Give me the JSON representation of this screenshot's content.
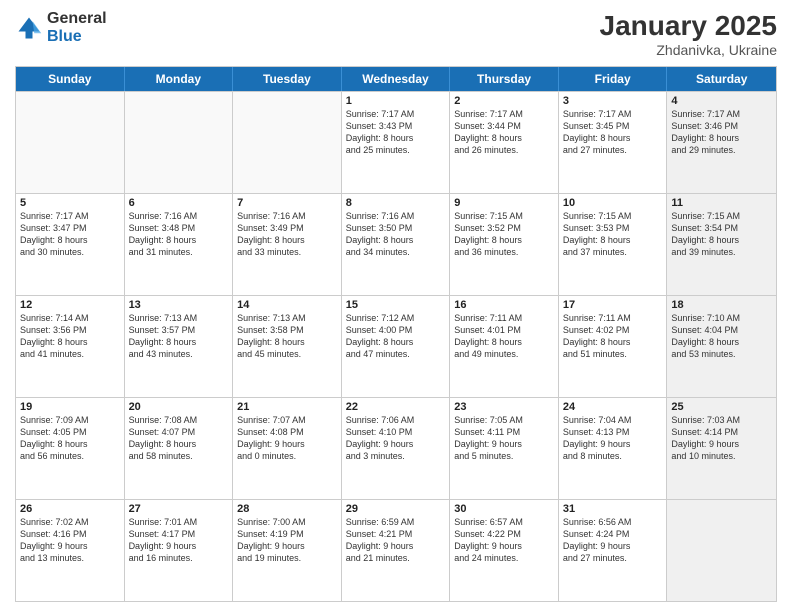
{
  "logo": {
    "general": "General",
    "blue": "Blue"
  },
  "title": {
    "month": "January 2025",
    "location": "Zhdanivka, Ukraine"
  },
  "header_days": [
    "Sunday",
    "Monday",
    "Tuesday",
    "Wednesday",
    "Thursday",
    "Friday",
    "Saturday"
  ],
  "rows": [
    [
      {
        "day": "",
        "text": "",
        "empty": true
      },
      {
        "day": "",
        "text": "",
        "empty": true
      },
      {
        "day": "",
        "text": "",
        "empty": true
      },
      {
        "day": "1",
        "text": "Sunrise: 7:17 AM\nSunset: 3:43 PM\nDaylight: 8 hours\nand 25 minutes."
      },
      {
        "day": "2",
        "text": "Sunrise: 7:17 AM\nSunset: 3:44 PM\nDaylight: 8 hours\nand 26 minutes."
      },
      {
        "day": "3",
        "text": "Sunrise: 7:17 AM\nSunset: 3:45 PM\nDaylight: 8 hours\nand 27 minutes."
      },
      {
        "day": "4",
        "text": "Sunrise: 7:17 AM\nSunset: 3:46 PM\nDaylight: 8 hours\nand 29 minutes.",
        "shaded": true
      }
    ],
    [
      {
        "day": "5",
        "text": "Sunrise: 7:17 AM\nSunset: 3:47 PM\nDaylight: 8 hours\nand 30 minutes."
      },
      {
        "day": "6",
        "text": "Sunrise: 7:16 AM\nSunset: 3:48 PM\nDaylight: 8 hours\nand 31 minutes."
      },
      {
        "day": "7",
        "text": "Sunrise: 7:16 AM\nSunset: 3:49 PM\nDaylight: 8 hours\nand 33 minutes."
      },
      {
        "day": "8",
        "text": "Sunrise: 7:16 AM\nSunset: 3:50 PM\nDaylight: 8 hours\nand 34 minutes."
      },
      {
        "day": "9",
        "text": "Sunrise: 7:15 AM\nSunset: 3:52 PM\nDaylight: 8 hours\nand 36 minutes."
      },
      {
        "day": "10",
        "text": "Sunrise: 7:15 AM\nSunset: 3:53 PM\nDaylight: 8 hours\nand 37 minutes."
      },
      {
        "day": "11",
        "text": "Sunrise: 7:15 AM\nSunset: 3:54 PM\nDaylight: 8 hours\nand 39 minutes.",
        "shaded": true
      }
    ],
    [
      {
        "day": "12",
        "text": "Sunrise: 7:14 AM\nSunset: 3:56 PM\nDaylight: 8 hours\nand 41 minutes."
      },
      {
        "day": "13",
        "text": "Sunrise: 7:13 AM\nSunset: 3:57 PM\nDaylight: 8 hours\nand 43 minutes."
      },
      {
        "day": "14",
        "text": "Sunrise: 7:13 AM\nSunset: 3:58 PM\nDaylight: 8 hours\nand 45 minutes."
      },
      {
        "day": "15",
        "text": "Sunrise: 7:12 AM\nSunset: 4:00 PM\nDaylight: 8 hours\nand 47 minutes."
      },
      {
        "day": "16",
        "text": "Sunrise: 7:11 AM\nSunset: 4:01 PM\nDaylight: 8 hours\nand 49 minutes."
      },
      {
        "day": "17",
        "text": "Sunrise: 7:11 AM\nSunset: 4:02 PM\nDaylight: 8 hours\nand 51 minutes."
      },
      {
        "day": "18",
        "text": "Sunrise: 7:10 AM\nSunset: 4:04 PM\nDaylight: 8 hours\nand 53 minutes.",
        "shaded": true
      }
    ],
    [
      {
        "day": "19",
        "text": "Sunrise: 7:09 AM\nSunset: 4:05 PM\nDaylight: 8 hours\nand 56 minutes."
      },
      {
        "day": "20",
        "text": "Sunrise: 7:08 AM\nSunset: 4:07 PM\nDaylight: 8 hours\nand 58 minutes."
      },
      {
        "day": "21",
        "text": "Sunrise: 7:07 AM\nSunset: 4:08 PM\nDaylight: 9 hours\nand 0 minutes."
      },
      {
        "day": "22",
        "text": "Sunrise: 7:06 AM\nSunset: 4:10 PM\nDaylight: 9 hours\nand 3 minutes."
      },
      {
        "day": "23",
        "text": "Sunrise: 7:05 AM\nSunset: 4:11 PM\nDaylight: 9 hours\nand 5 minutes."
      },
      {
        "day": "24",
        "text": "Sunrise: 7:04 AM\nSunset: 4:13 PM\nDaylight: 9 hours\nand 8 minutes."
      },
      {
        "day": "25",
        "text": "Sunrise: 7:03 AM\nSunset: 4:14 PM\nDaylight: 9 hours\nand 10 minutes.",
        "shaded": true
      }
    ],
    [
      {
        "day": "26",
        "text": "Sunrise: 7:02 AM\nSunset: 4:16 PM\nDaylight: 9 hours\nand 13 minutes."
      },
      {
        "day": "27",
        "text": "Sunrise: 7:01 AM\nSunset: 4:17 PM\nDaylight: 9 hours\nand 16 minutes."
      },
      {
        "day": "28",
        "text": "Sunrise: 7:00 AM\nSunset: 4:19 PM\nDaylight: 9 hours\nand 19 minutes."
      },
      {
        "day": "29",
        "text": "Sunrise: 6:59 AM\nSunset: 4:21 PM\nDaylight: 9 hours\nand 21 minutes."
      },
      {
        "day": "30",
        "text": "Sunrise: 6:57 AM\nSunset: 4:22 PM\nDaylight: 9 hours\nand 24 minutes."
      },
      {
        "day": "31",
        "text": "Sunrise: 6:56 AM\nSunset: 4:24 PM\nDaylight: 9 hours\nand 27 minutes."
      },
      {
        "day": "",
        "text": "",
        "empty": true,
        "shaded": true
      }
    ]
  ]
}
